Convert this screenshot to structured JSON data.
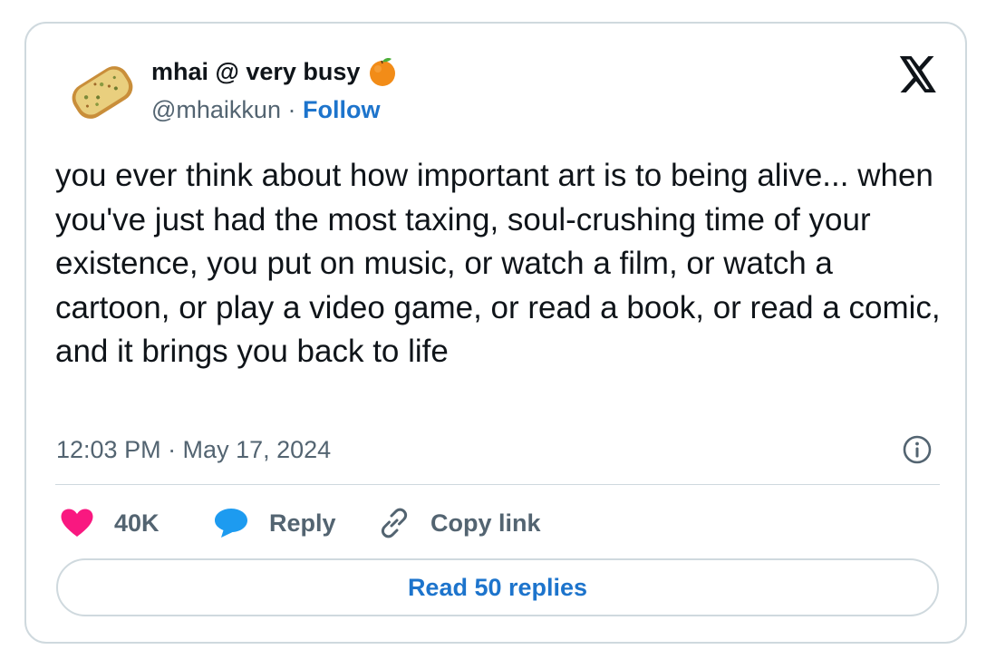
{
  "author": {
    "display_name": "mhai @ very busy",
    "handle": "@mhaikkun",
    "separator": " · ",
    "follow_label": "Follow"
  },
  "tweet": {
    "text": "you ever think about how important art is to being alive... when you've just had the most taxing, soul-crushing time of your existence, you put on music, or watch a film, or watch a cartoon, or play a video game, or read a book, or read a comic, and it brings you back to life",
    "timestamp": "12:03 PM · May 17, 2024"
  },
  "actions": {
    "likes": "40K",
    "reply_label": "Reply",
    "copy_link_label": "Copy link"
  },
  "read_replies_label": "Read 50 replies",
  "colors": {
    "like": "#f91880",
    "reply": "#1d9bf0",
    "link": "#1d74cc",
    "secondary_text": "#536471",
    "border": "#cfd9de"
  },
  "icons": [
    "avatar-garlic-bread",
    "orange-emoji-icon",
    "x-logo-icon",
    "info-icon",
    "heart-icon",
    "reply-bubble-icon",
    "link-icon"
  ]
}
